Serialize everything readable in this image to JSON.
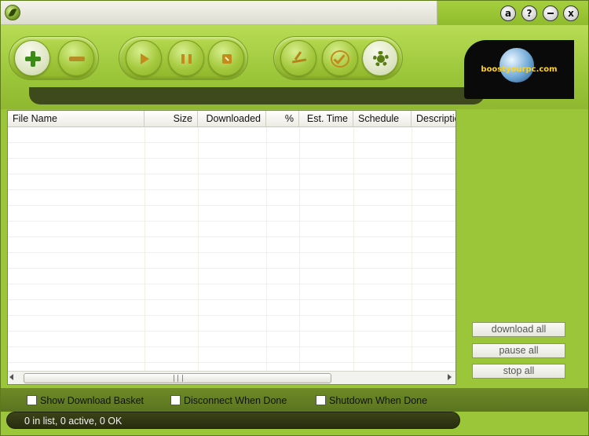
{
  "window": {
    "controls": {
      "about": "a",
      "help": "?",
      "close": "x"
    }
  },
  "toolbar": {
    "buttons": [
      "add-icon",
      "remove-icon",
      "play-icon",
      "pause-icon",
      "stop-icon",
      "schedule-icon",
      "check-icon",
      "settings-icon"
    ]
  },
  "logo": {
    "text": "boostyourpc.com"
  },
  "list": {
    "columns": [
      "File Name",
      "Size",
      "Downloaded",
      "%",
      "Est. Time",
      "Schedule",
      "Description"
    ],
    "rows": []
  },
  "actions": {
    "download_all": "download all",
    "pause_all": "pause all",
    "stop_all": "stop all"
  },
  "options": {
    "show_basket": "Show Download Basket",
    "disconnect_when_done": "Disconnect When Done",
    "shutdown_when_done": "Shutdown When Done"
  },
  "status": {
    "text": "0 in list, 0 active, 0 OK"
  },
  "colors": {
    "brand_green": "#9cc63a",
    "dark_band": "#3f4a1c",
    "accent_gold": "#c38a1c"
  }
}
